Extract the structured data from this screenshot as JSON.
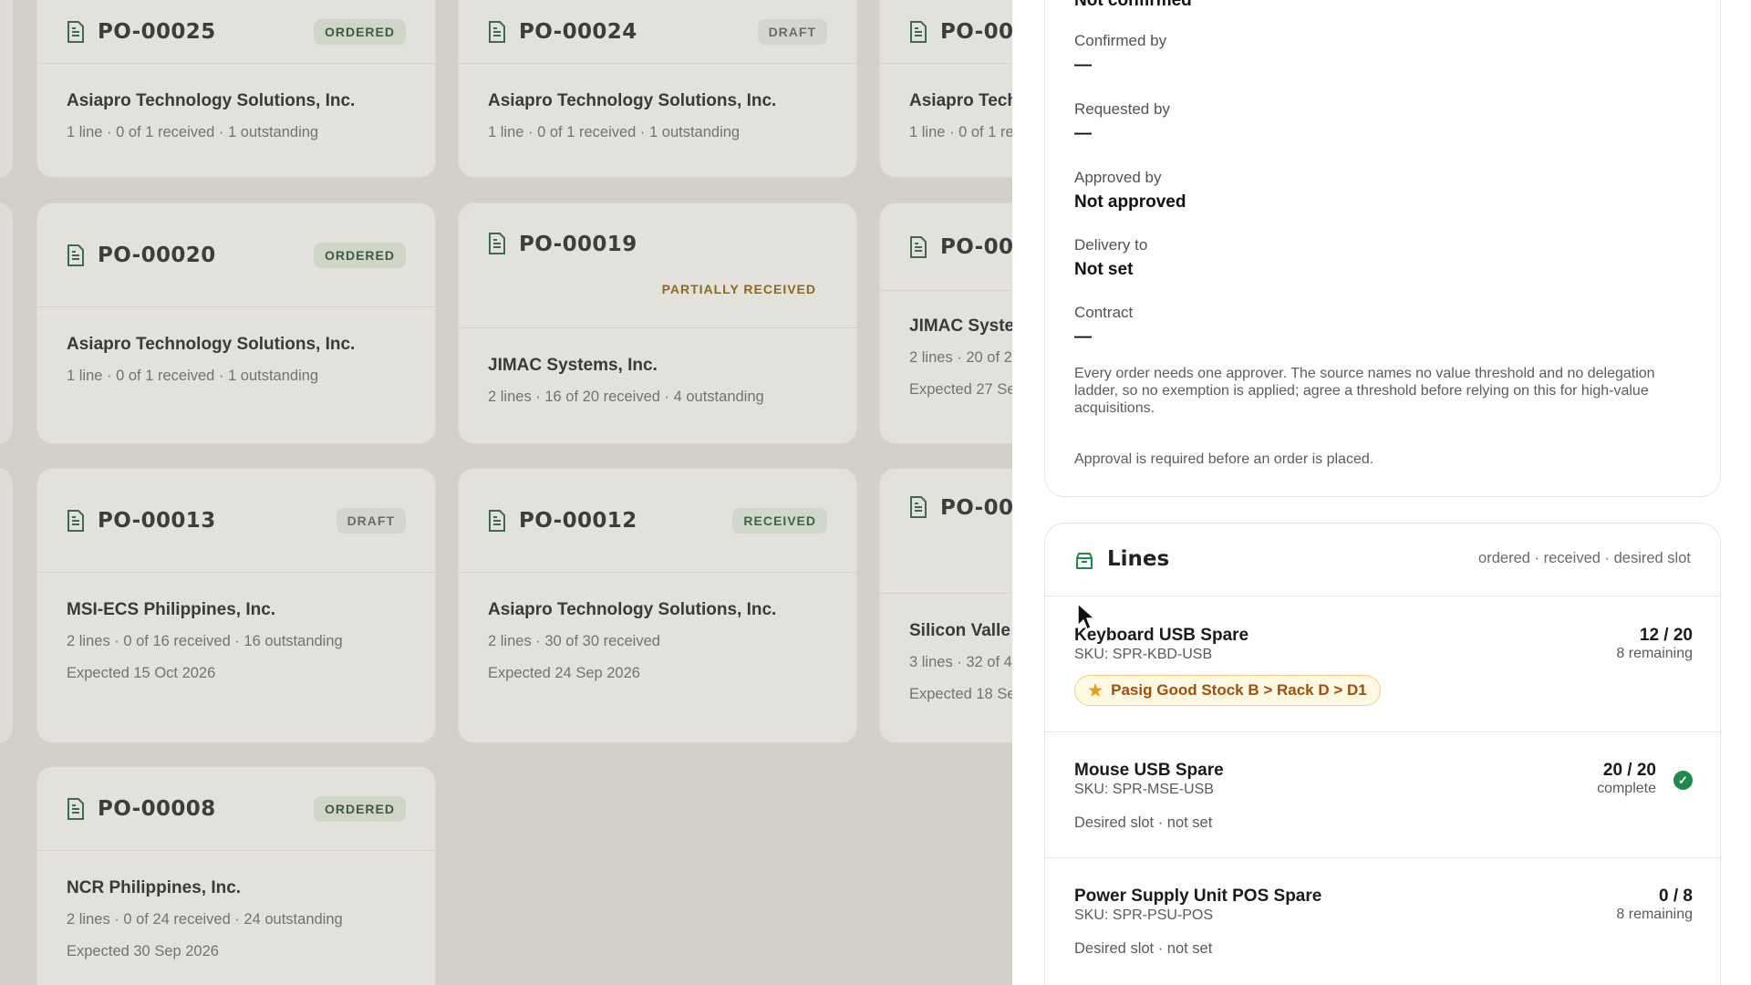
{
  "orders": [
    {
      "id": "PO-00025",
      "status": "ORDERED",
      "vendor": "Asiapro Technology Solutions, Inc.",
      "summary": "1 line · 0 of 1 received · 1 outstanding",
      "expected": ""
    },
    {
      "id": "PO-00024",
      "status": "DRAFT",
      "vendor": "Asiapro Technology Solutions, Inc.",
      "summary": "1 line · 0 of 1 received · 1 outstanding",
      "expected": ""
    },
    {
      "id": "PO-00",
      "status": "",
      "vendor": "Asiapro Tech",
      "summary": "1 line · 0 of 1 re",
      "expected": ""
    },
    {
      "id": "PO-00020",
      "status": "ORDERED",
      "vendor": "Asiapro Technology Solutions, Inc.",
      "summary": "1 line · 0 of 1 received · 1 outstanding",
      "expected": ""
    },
    {
      "id": "PO-00019",
      "status": "PARTIALLY RECEIVED",
      "vendor": "JIMAC Systems, Inc.",
      "summary": "2 lines · 16 of 20 received · 4 outstanding",
      "expected": ""
    },
    {
      "id": "PO-00",
      "status": "",
      "vendor": "JIMAC Syste",
      "summary": "2 lines · 20 of 2",
      "expected": "Expected 27 Se"
    },
    {
      "id": "PO-00013",
      "status": "DRAFT",
      "vendor": "MSI-ECS Philippines, Inc.",
      "summary": "2 lines · 0 of 16 received · 16 outstanding",
      "expected": "Expected 15 Oct 2026"
    },
    {
      "id": "PO-00012",
      "status": "RECEIVED",
      "vendor": "Asiapro Technology Solutions, Inc.",
      "summary": "2 lines · 30 of 30 received",
      "expected": "Expected 24 Sep 2026"
    },
    {
      "id": "PO-00",
      "status": "",
      "vendor": "Silicon Valle",
      "summary": "3 lines · 32 of 4",
      "expected": "Expected 18 Se"
    },
    {
      "id": "PO-00008",
      "status": "ORDERED",
      "vendor": "NCR Philippines, Inc.",
      "summary": "2 lines · 0 of 24 received · 24 outstanding",
      "expected": "Expected 30 Sep 2026"
    }
  ],
  "details": {
    "top_value": "Not confirmed",
    "confirmed_by_label": "Confirmed by",
    "confirmed_by_value": "—",
    "requested_by_label": "Requested by",
    "requested_by_value": "—",
    "approved_by_label": "Approved by",
    "approved_by_value": "Not approved",
    "delivery_to_label": "Delivery to",
    "delivery_to_value": "Not set",
    "contract_label": "Contract",
    "contract_value": "—",
    "approver_note": "Every order needs one approver. The source names no value threshold and no delegation ladder, so no exemption is applied; agree a threshold before relying on this for high-value acquisitions.",
    "approval_note": "Approval is required before an order is placed."
  },
  "lines": {
    "title": "Lines",
    "hint": "ordered · received · desired slot",
    "items": [
      {
        "name": "Keyboard USB Spare",
        "sku": "SKU: SPR-KBD-USB",
        "qty": "12 / 20",
        "sub": "8 remaining",
        "slot": "Pasig Good Stock B > Rack D > D1"
      },
      {
        "name": "Mouse USB Spare",
        "sku": "SKU: SPR-MSE-USB",
        "qty": "20 / 20",
        "sub": "complete",
        "slot": "Desired slot · not set"
      },
      {
        "name": "Power Supply Unit POS Spare",
        "sku": "SKU: SPR-PSU-POS",
        "qty": "0 / 8",
        "sub": "8 remaining",
        "slot": "Desired slot · not set"
      }
    ]
  },
  "icons": {
    "card": "document-icon",
    "lines": "package-icon",
    "slot": "star-icon",
    "done": "check-circle-icon"
  },
  "colors": {
    "accent_green": "#1f8a4c",
    "slot_text": "#a0500c",
    "slot_bg": "#fff8e3"
  }
}
